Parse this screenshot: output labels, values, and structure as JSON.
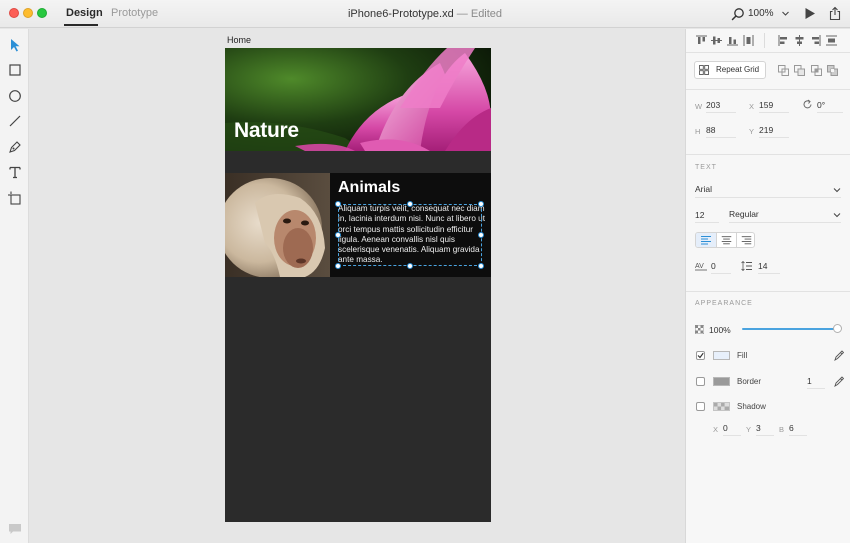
{
  "window": {
    "title": "iPhone6-Prototype.xd",
    "title_suffix": "— Edited"
  },
  "tabs": [
    {
      "label": "Design",
      "active": true
    },
    {
      "label": "Prototype",
      "active": false
    }
  ],
  "zoom": "100%",
  "tools": [
    "select-arrow-icon",
    "rectangle-icon",
    "ellipse-icon",
    "line-icon",
    "pen-icon",
    "text-icon",
    "artboard-icon"
  ],
  "artboard": {
    "name": "Home",
    "nature_title": "Nature",
    "animals_title": "Animals",
    "animals_body": "Aliquam turpis velit, consequat nec diam in, lacinia interdum nisi. Nunc at libero ut orci tempus mattis sollicitudin efficitur ligula. Aenean convallis nisl quis scelerisque venenatis. Aliquam gravida ante massa."
  },
  "panel": {
    "repeat_grid_label": "Repeat Grid",
    "transform": {
      "w_label": "W",
      "w": "203",
      "x_label": "X",
      "x": "159",
      "rotation": "0°",
      "h_label": "H",
      "h": "88",
      "y_label": "Y",
      "y": "219"
    },
    "text": {
      "section": "TEXT",
      "font_family": "Arial",
      "font_size": "12",
      "font_weight": "Regular",
      "char_spacing": "0",
      "line_spacing": "14"
    },
    "appearance": {
      "section": "APPEARANCE",
      "opacity": "100%",
      "opacity_fraction": 1.0,
      "fill_label": "Fill",
      "fill_checked": true,
      "fill_color": "#e8f0fb",
      "border_label": "Border",
      "border_checked": false,
      "border_width": "1",
      "border_color": "#9a9a9a",
      "shadow_label": "Shadow",
      "shadow_checked": false,
      "shadow_x_label": "X",
      "shadow_x": "0",
      "shadow_y_label": "Y",
      "shadow_y": "3",
      "shadow_b_label": "B",
      "shadow_b": "6"
    }
  },
  "colors": {
    "accent": "#2b8fd6",
    "artboard_bg": "#2b2b2b",
    "card_bg": "#0d0d0d"
  }
}
